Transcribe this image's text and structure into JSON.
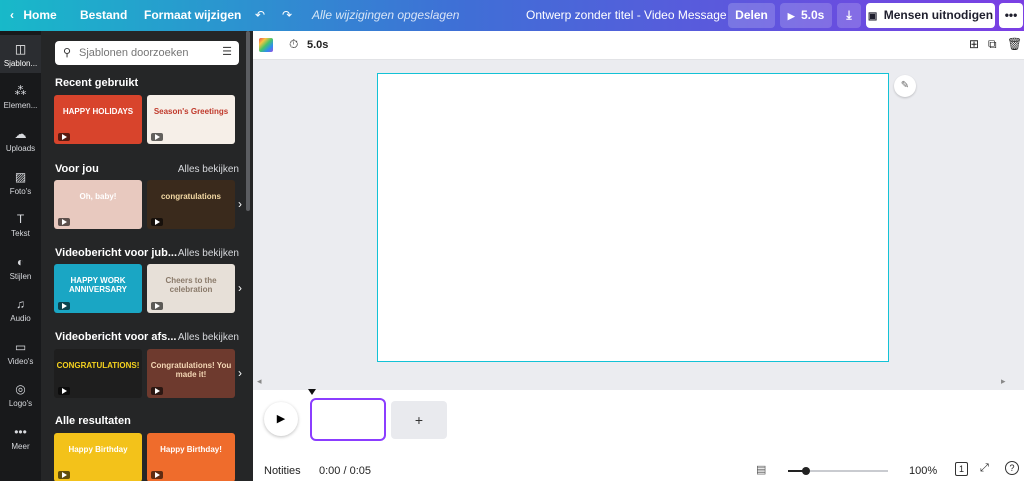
{
  "topbar": {
    "home": "Home",
    "file": "Bestand",
    "resize": "Formaat wijzigen",
    "save_status": "Alle wijzigingen opgeslagen",
    "doc_title": "Ontwerp zonder titel - Video Message",
    "share": "Delen",
    "present_duration": "5.0s",
    "invite": "Mensen uitnodigen"
  },
  "rail": {
    "items": [
      {
        "label": "Sjablon...",
        "icon": "templates-icon"
      },
      {
        "label": "Elemen...",
        "icon": "elements-icon"
      },
      {
        "label": "Uploads",
        "icon": "upload-icon"
      },
      {
        "label": "Foto's",
        "icon": "photo-icon"
      },
      {
        "label": "Tekst",
        "icon": "text-icon"
      },
      {
        "label": "Stijlen",
        "icon": "styles-icon"
      },
      {
        "label": "Audio",
        "icon": "audio-icon"
      },
      {
        "label": "Video's",
        "icon": "video-icon"
      },
      {
        "label": "Logo's",
        "icon": "logo-icon"
      },
      {
        "label": "Meer",
        "icon": "more-icon"
      }
    ]
  },
  "panel": {
    "search_placeholder": "Sjablonen doorzoeken",
    "sections": [
      {
        "title": "Recent gebruikt",
        "link": ""
      },
      {
        "title": "Voor jou",
        "link": "Alles bekijken"
      },
      {
        "title": "Videobericht voor jub...",
        "link": "Alles bekijken"
      },
      {
        "title": "Videobericht voor afs...",
        "link": "Alles bekijken"
      },
      {
        "title": "Alle resultaten",
        "link": ""
      }
    ],
    "thumbs": [
      {
        "text": "HAPPY HOLIDAYS",
        "bg": "#d8442c",
        "fg": "#ffffff"
      },
      {
        "text": "Season's Greetings",
        "bg": "#f6efe8",
        "fg": "#c0392b"
      },
      {
        "text": "Oh, baby!",
        "bg": "#e8c9bf",
        "fg": "#ffffff"
      },
      {
        "text": "congratulations",
        "bg": "#3a2a1c",
        "fg": "#f3d9a4"
      },
      {
        "text": "HAPPY WORK ANNIVERSARY",
        "bg": "#1aa6c4",
        "fg": "#ffffff"
      },
      {
        "text": "Cheers to the celebration",
        "bg": "#e7e0d8",
        "fg": "#8a7a6a"
      },
      {
        "text": "CONGRATULATIONS!",
        "bg": "#1e1e1e",
        "fg": "#f5d21e"
      },
      {
        "text": "Congratulations! You made it!",
        "bg": "#6e3a2e",
        "fg": "#f4d7b5"
      },
      {
        "text": "Happy Birthday",
        "bg": "#f3c21a",
        "fg": "#ffffff"
      },
      {
        "text": "Happy Birthday!",
        "bg": "#ef6c2c",
        "fg": "#ffffff"
      }
    ]
  },
  "toolbar": {
    "duration": "5.0s"
  },
  "timeline": {
    "add": "+"
  },
  "footer": {
    "notes": "Notities",
    "time": "0:00 / 0:05",
    "zoom": "100%",
    "page_count": "1"
  }
}
